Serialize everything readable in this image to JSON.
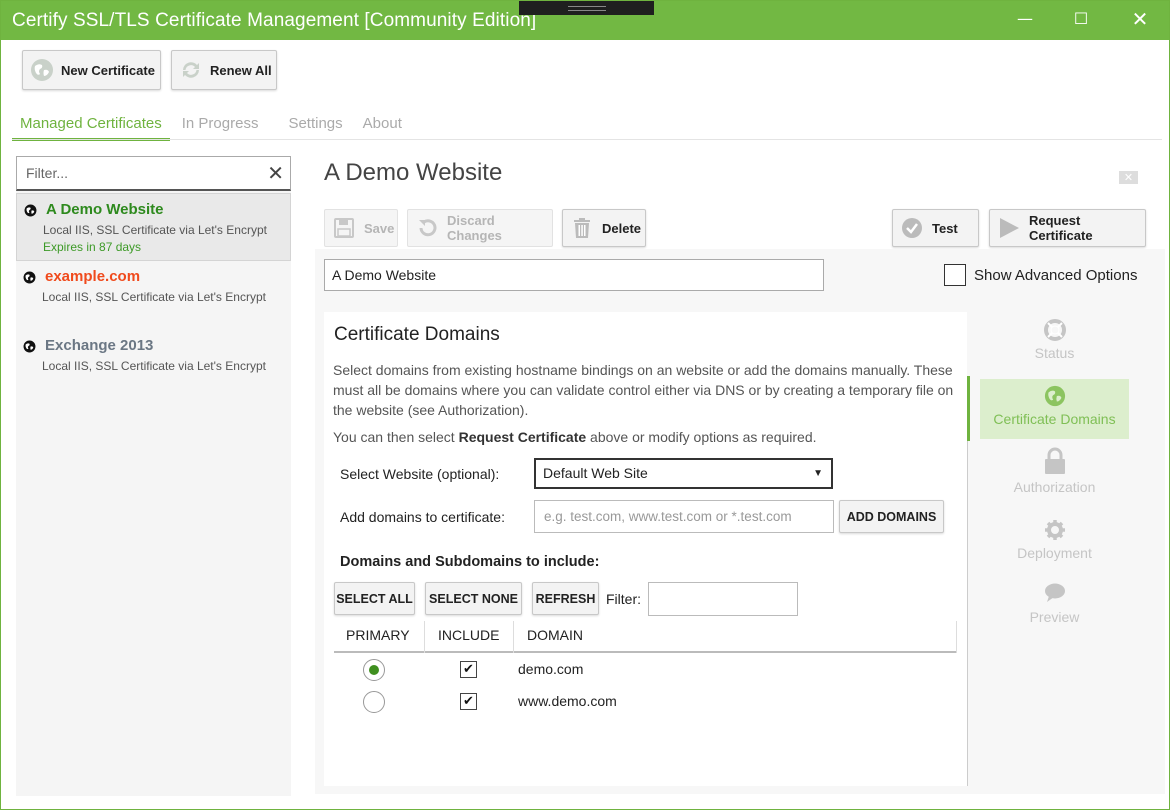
{
  "window": {
    "title": "Certify SSL/TLS Certificate Management [Community Edition]",
    "minimize": "—",
    "maximize": "☐",
    "close": "✕"
  },
  "toolbar": {
    "new_certificate": "New Certificate",
    "renew_all": "Renew All"
  },
  "tabs": [
    {
      "label": "Managed Certificates",
      "active": true
    },
    {
      "label": "In Progress",
      "active": false
    },
    {
      "label": "Settings",
      "active": false
    },
    {
      "label": "About",
      "active": false
    }
  ],
  "sidebar": {
    "filter_placeholder": "Filter...",
    "clear": "✕",
    "items": [
      {
        "name": "A Demo Website",
        "desc": "Local IIS, SSL Certificate via Let's Encrypt",
        "expiry": "Expires in 87 days",
        "color": "#2e8a1e"
      },
      {
        "name": "example.com",
        "desc": "Local IIS, SSL Certificate via Let's Encrypt",
        "color": "#f04a1c"
      },
      {
        "name": "Exchange 2013",
        "desc": "Local IIS, SSL Certificate via Let's Encrypt",
        "color": "#6b7784"
      }
    ]
  },
  "main": {
    "title": "A Demo Website",
    "close_badge": "✕",
    "actions": {
      "save": "Save",
      "discard": "Discard Changes",
      "delete": "Delete",
      "test": "Test",
      "request": "Request Certificate"
    },
    "name_value": "A Demo Website",
    "show_advanced": "Show Advanced Options",
    "section": {
      "title": "Certificate Domains",
      "desc": "Select domains from existing hostname bindings on an website or add the domains manually. These must all be domains where you can validate control either via DNS or by creating a temporary file on the website (see Authorization).",
      "desc2_prefix": "You can then select ",
      "desc2_bold": "Request Certificate",
      "desc2_suffix": " above or modify options as required.",
      "select_website_label": "Select Website (optional):",
      "select_website_value": "Default Web Site",
      "add_domains_label": "Add domains to certificate:",
      "add_domains_placeholder": "e.g. test.com, www.test.com or *.test.com",
      "add_domains_button": "ADD DOMAINS",
      "subheading": "Domains and Subdomains to include:",
      "select_all": "SELECT ALL",
      "select_none": "SELECT NONE",
      "refresh": "REFRESH",
      "filter_label": "Filter:",
      "columns": [
        "PRIMARY",
        "INCLUDE",
        "DOMAIN"
      ],
      "rows": [
        {
          "primary": true,
          "include": true,
          "domain": "demo.com"
        },
        {
          "primary": false,
          "include": true,
          "domain": "www.demo.com"
        }
      ]
    }
  },
  "nav": [
    {
      "label": "Status",
      "icon": "lifebuoy-icon",
      "active": false
    },
    {
      "label": "Certificate Domains",
      "icon": "globe-icon",
      "active": true
    },
    {
      "label": "Authorization",
      "icon": "lock-icon",
      "active": false
    },
    {
      "label": "Deployment",
      "icon": "gear-icon",
      "active": false
    },
    {
      "label": "Preview",
      "icon": "speech-bubble-icon",
      "active": false
    }
  ],
  "colors": {
    "accent": "#6fb33f",
    "titlebar": "#72b843"
  }
}
